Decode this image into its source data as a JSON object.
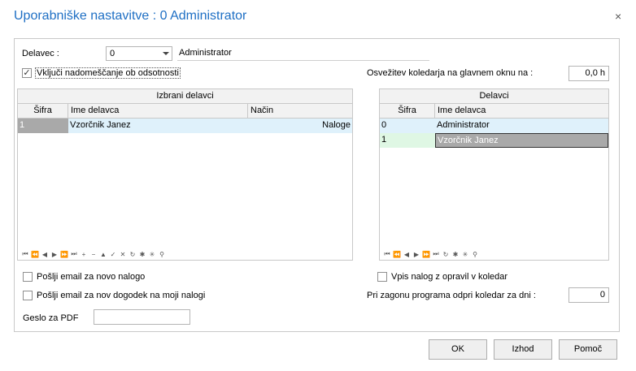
{
  "dialog": {
    "title": "Uporabniške nastavitve : 0 Administrator",
    "close_glyph": "×"
  },
  "worker": {
    "label": "Delavec :",
    "value": "0",
    "name": "Administrator"
  },
  "substitution_checkbox": {
    "label": "Vključi nadomeščanje ob odsotnosti",
    "checked": true,
    "glyph": "✓"
  },
  "refresh": {
    "label": "Osvežitev koledarja na glavnem oknu na :",
    "value": "0,0 h"
  },
  "selected_grid": {
    "title": "Izbrani delavci",
    "columns": [
      "Šifra",
      "Ime delavca",
      "Način"
    ],
    "rows": [
      {
        "code": "1",
        "name": "Vzorčnik Janez",
        "mode": "Naloge"
      }
    ]
  },
  "workers_grid": {
    "title": "Delavci",
    "columns": [
      "Šifra",
      "Ime delavca"
    ],
    "rows": [
      {
        "code": "0",
        "name": "Administrator"
      },
      {
        "code": "1",
        "name": "Vzorčnik Janez"
      }
    ]
  },
  "nav_icons_left": [
    "⏮",
    "⏪",
    "◀",
    "▶",
    "⏩",
    "⏭",
    "+",
    "−",
    "▲",
    "✓",
    "✕",
    "↻",
    "✱",
    "✳",
    "⚲"
  ],
  "nav_icons_right": [
    "⏮",
    "⏪",
    "◀",
    "▶",
    "⏩",
    "⏭",
    "↻",
    "✱",
    "✳",
    "⚲"
  ],
  "options": {
    "email_new_task": "Pošlji email za novo nalogo",
    "email_new_event": "Pošlji email za nov dogodek na moji nalogi",
    "write_task": "Vpis nalog z opravil v koledar",
    "open_calendar_label": "Pri zagonu programa odpri koledar za dni :",
    "open_calendar_value": "0",
    "pdf_password_label": "Geslo za PDF"
  },
  "buttons": {
    "ok": "OK",
    "exit": "Izhod",
    "help": "Pomoč"
  },
  "colors": {
    "title": "#1e6fc4",
    "row_highlight": "#dff1fb",
    "row_selected": "#a9a9a9",
    "code_green": "#dff7e4"
  }
}
